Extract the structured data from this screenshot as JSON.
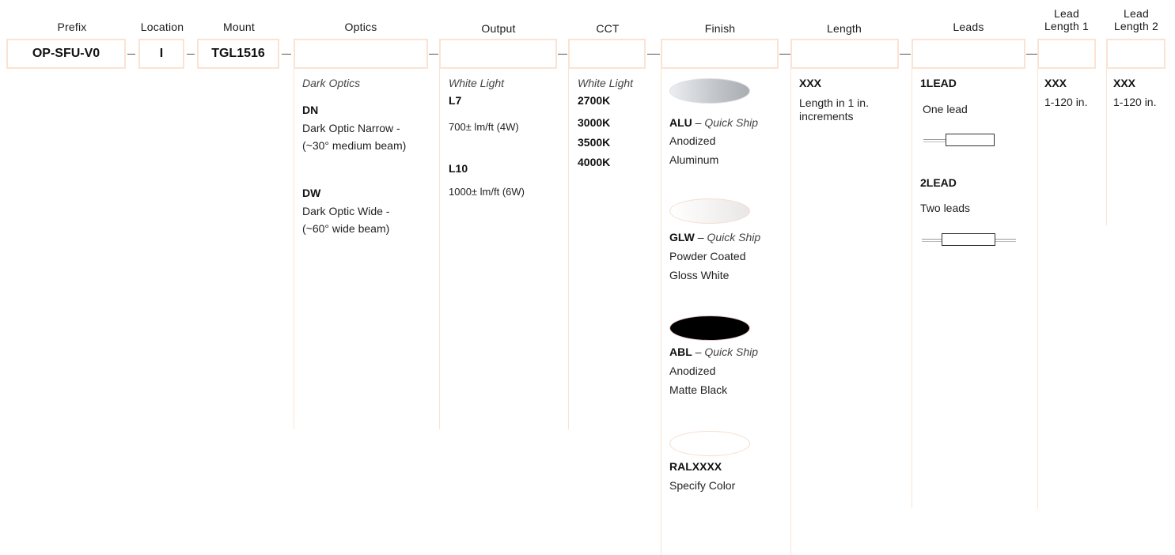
{
  "headers": {
    "prefix": "Prefix",
    "location": "Location",
    "mount": "Mount",
    "optics": "Optics",
    "output": "Output",
    "cct": "CCT",
    "finish": "Finish",
    "length": "Length",
    "leads": "Leads",
    "lead_length_1": "Lead\nLength 1",
    "lead_length_2": "Lead\nLength 2"
  },
  "boxes": {
    "prefix": "OP-SFU-V0",
    "location": "I",
    "mount": "TGL1516"
  },
  "optics": {
    "group": "Dark Optics",
    "options": [
      {
        "code": "DN",
        "line1": "Dark Optic Narrow -",
        "line2": "(~30° medium beam)"
      },
      {
        "code": "DW",
        "line1": "Dark Optic Wide -",
        "line2": "(~60° wide beam)"
      }
    ]
  },
  "output": {
    "group": "White Light",
    "options": [
      {
        "code": "L7",
        "desc": "700± lm/ft (4W)"
      },
      {
        "code": "L10",
        "desc": "1000± lm/ft (6W)"
      }
    ]
  },
  "cct": {
    "group": "White Light",
    "options": [
      "2700K",
      "3000K",
      "3500K",
      "4000K"
    ]
  },
  "finish": {
    "options": [
      {
        "code": "ALU",
        "tag": "Quick Ship",
        "line1": "Anodized",
        "line2": "Aluminum",
        "swatch_color": "#c9ccd0"
      },
      {
        "code": "GLW",
        "tag": "Quick Ship",
        "line1": "Powder Coated",
        "line2": "Gloss White",
        "swatch_color": "#f4f2f1"
      },
      {
        "code": "ABL",
        "tag": "Quick Ship",
        "line1": "Anodized",
        "line2": "Matte Black",
        "swatch_color": "#000000"
      },
      {
        "code": "RALXXXX",
        "tag": "",
        "line1": "Specify Color",
        "line2": "",
        "swatch_color": "#ffffff"
      }
    ],
    "dash": "–"
  },
  "length": {
    "code": "XXX",
    "line1": "Length in 1 in.",
    "line2": "increments"
  },
  "leads": {
    "options": [
      {
        "code": "1LEAD",
        "desc": "One lead"
      },
      {
        "code": "2LEAD",
        "desc": "Two leads"
      }
    ]
  },
  "lead_length_1": {
    "code": "XXX",
    "desc": "1-120 in."
  },
  "lead_length_2": {
    "code": "XXX",
    "desc": "1-120 in."
  },
  "colors": {
    "box_border": "#fbe3d3",
    "column_rule": "#fbe3d3"
  }
}
